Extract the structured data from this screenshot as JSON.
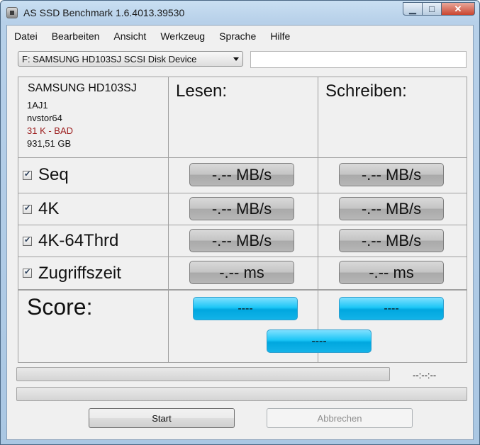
{
  "window": {
    "title": "AS SSD Benchmark 1.6.4013.39530"
  },
  "menu": [
    "Datei",
    "Bearbeiten",
    "Ansicht",
    "Werkzeug",
    "Sprache",
    "Hilfe"
  ],
  "drive_select": {
    "value": "F: SAMSUNG HD103SJ SCSI Disk Device"
  },
  "device": {
    "model": "SAMSUNG HD103SJ",
    "firmware": "1AJ1",
    "driver": "nvstor64",
    "alignment": "31 K - BAD",
    "size": "931,51 GB"
  },
  "columns": {
    "read": "Lesen:",
    "write": "Schreiben:"
  },
  "tests": [
    {
      "label": "Seq",
      "checked": true,
      "read": "-.-- MB/s",
      "write": "-.-- MB/s"
    },
    {
      "label": "4K",
      "checked": true,
      "read": "-.-- MB/s",
      "write": "-.-- MB/s"
    },
    {
      "label": "4K-64Thrd",
      "checked": true,
      "read": "-.-- MB/s",
      "write": "-.-- MB/s"
    },
    {
      "label": "Zugriffszeit",
      "checked": true,
      "read": "-.-- ms",
      "write": "-.-- ms"
    }
  ],
  "score": {
    "label": "Score:",
    "read": "----",
    "write": "----",
    "total": "----"
  },
  "progress": {
    "time": "--:--:--",
    "value": 0
  },
  "buttons": {
    "start": "Start",
    "cancel": "Abbrechen"
  },
  "colors": {
    "score_accent": "#1cc6f6",
    "bad_text": "#9b1b1b"
  }
}
